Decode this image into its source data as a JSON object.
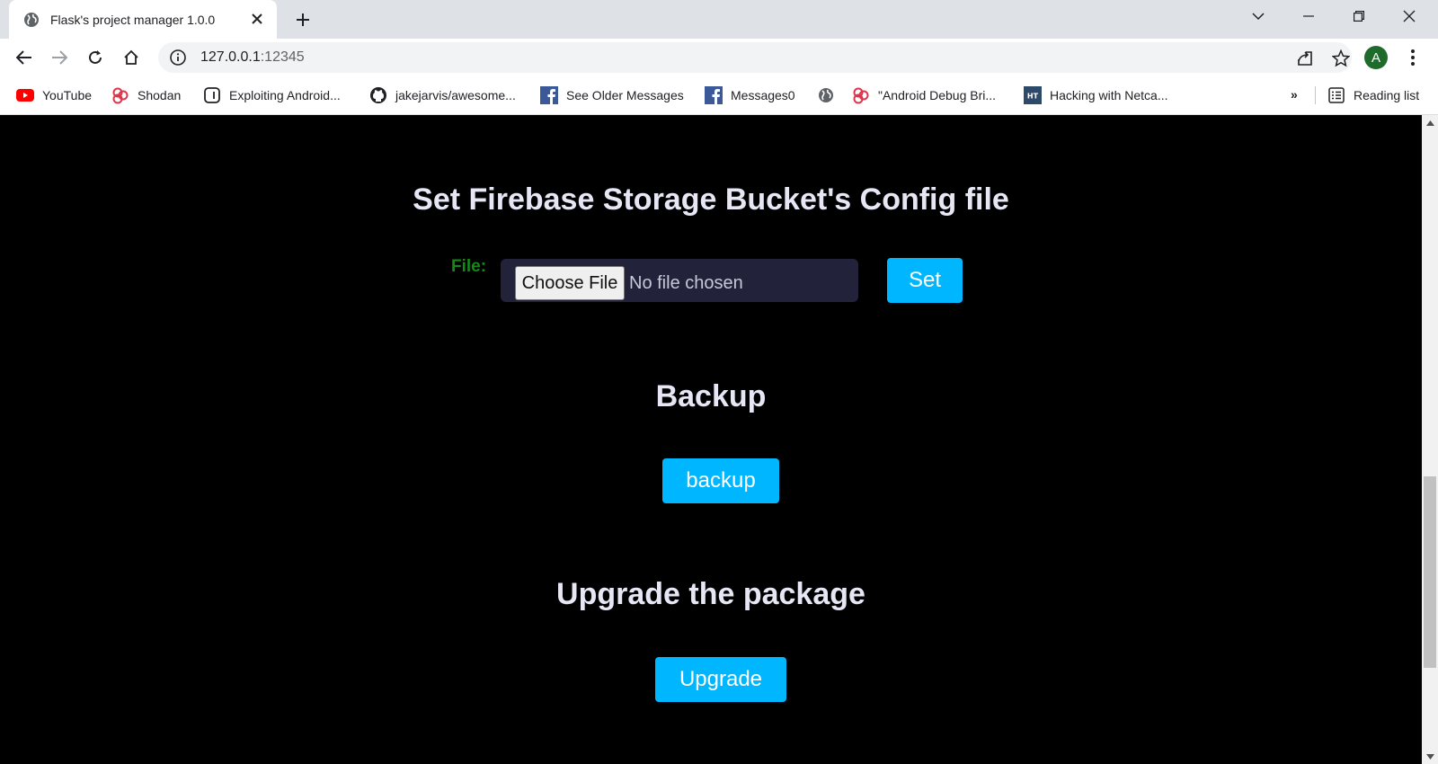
{
  "browser": {
    "tab": {
      "title": "Flask's project manager 1.0.0",
      "icon": "globe-icon"
    },
    "url": {
      "host": "127.0.0.1",
      "port": ":12345"
    },
    "profile_initial": "A",
    "bookmarks": [
      {
        "label": "YouTube",
        "icon": "youtube-icon"
      },
      {
        "label": "Shodan",
        "icon": "shodan-icon"
      },
      {
        "label": "Exploiting Android...",
        "icon": "bracket-icon"
      },
      {
        "label": "jakejarvis/awesome...",
        "icon": "github-icon"
      },
      {
        "label": "See Older Messages",
        "icon": "facebook-icon"
      },
      {
        "label": "Messages0",
        "icon": "facebook-icon"
      },
      {
        "label": "",
        "icon": "globe-icon"
      },
      {
        "label": "\"Android Debug Bri...",
        "icon": "shodan-icon"
      },
      {
        "label": "Hacking with Netca...",
        "icon": "ht-icon"
      }
    ],
    "more_label": "»",
    "reading_list": "Reading list"
  },
  "page": {
    "firebase_title": "Set Firebase Storage Bucket's Config file",
    "file_label": "File:",
    "choose_file_label": "Choose File",
    "no_file_text": "No file chosen",
    "set_label": "Set",
    "backup_title": "Backup",
    "backup_label": "backup",
    "upgrade_title": "Upgrade the package",
    "upgrade_label": "Upgrade"
  },
  "colors": {
    "page_bg": "#000000",
    "heading": "#e6e6f5",
    "button": "#00b7ff",
    "file_label": "#148a14",
    "file_box": "#22223a"
  }
}
